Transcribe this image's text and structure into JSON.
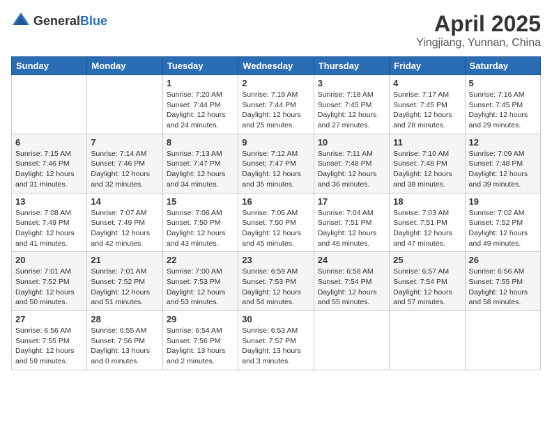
{
  "header": {
    "logo_general": "General",
    "logo_blue": "Blue",
    "month": "April 2025",
    "location": "Yingjiang, Yunnan, China"
  },
  "weekdays": [
    "Sunday",
    "Monday",
    "Tuesday",
    "Wednesday",
    "Thursday",
    "Friday",
    "Saturday"
  ],
  "weeks": [
    [
      {
        "day": "",
        "info": ""
      },
      {
        "day": "",
        "info": ""
      },
      {
        "day": "1",
        "info": "Sunrise: 7:20 AM\nSunset: 7:44 PM\nDaylight: 12 hours\nand 24 minutes."
      },
      {
        "day": "2",
        "info": "Sunrise: 7:19 AM\nSunset: 7:44 PM\nDaylight: 12 hours\nand 25 minutes."
      },
      {
        "day": "3",
        "info": "Sunrise: 7:18 AM\nSunset: 7:45 PM\nDaylight: 12 hours\nand 27 minutes."
      },
      {
        "day": "4",
        "info": "Sunrise: 7:17 AM\nSunset: 7:45 PM\nDaylight: 12 hours\nand 28 minutes."
      },
      {
        "day": "5",
        "info": "Sunrise: 7:16 AM\nSunset: 7:45 PM\nDaylight: 12 hours\nand 29 minutes."
      }
    ],
    [
      {
        "day": "6",
        "info": "Sunrise: 7:15 AM\nSunset: 7:46 PM\nDaylight: 12 hours\nand 31 minutes."
      },
      {
        "day": "7",
        "info": "Sunrise: 7:14 AM\nSunset: 7:46 PM\nDaylight: 12 hours\nand 32 minutes."
      },
      {
        "day": "8",
        "info": "Sunrise: 7:13 AM\nSunset: 7:47 PM\nDaylight: 12 hours\nand 34 minutes."
      },
      {
        "day": "9",
        "info": "Sunrise: 7:12 AM\nSunset: 7:47 PM\nDaylight: 12 hours\nand 35 minutes."
      },
      {
        "day": "10",
        "info": "Sunrise: 7:11 AM\nSunset: 7:48 PM\nDaylight: 12 hours\nand 36 minutes."
      },
      {
        "day": "11",
        "info": "Sunrise: 7:10 AM\nSunset: 7:48 PM\nDaylight: 12 hours\nand 38 minutes."
      },
      {
        "day": "12",
        "info": "Sunrise: 7:09 AM\nSunset: 7:48 PM\nDaylight: 12 hours\nand 39 minutes."
      }
    ],
    [
      {
        "day": "13",
        "info": "Sunrise: 7:08 AM\nSunset: 7:49 PM\nDaylight: 12 hours\nand 41 minutes."
      },
      {
        "day": "14",
        "info": "Sunrise: 7:07 AM\nSunset: 7:49 PM\nDaylight: 12 hours\nand 42 minutes."
      },
      {
        "day": "15",
        "info": "Sunrise: 7:06 AM\nSunset: 7:50 PM\nDaylight: 12 hours\nand 43 minutes."
      },
      {
        "day": "16",
        "info": "Sunrise: 7:05 AM\nSunset: 7:50 PM\nDaylight: 12 hours\nand 45 minutes."
      },
      {
        "day": "17",
        "info": "Sunrise: 7:04 AM\nSunset: 7:51 PM\nDaylight: 12 hours\nand 46 minutes."
      },
      {
        "day": "18",
        "info": "Sunrise: 7:03 AM\nSunset: 7:51 PM\nDaylight: 12 hours\nand 47 minutes."
      },
      {
        "day": "19",
        "info": "Sunrise: 7:02 AM\nSunset: 7:52 PM\nDaylight: 12 hours\nand 49 minutes."
      }
    ],
    [
      {
        "day": "20",
        "info": "Sunrise: 7:01 AM\nSunset: 7:52 PM\nDaylight: 12 hours\nand 50 minutes."
      },
      {
        "day": "21",
        "info": "Sunrise: 7:01 AM\nSunset: 7:52 PM\nDaylight: 12 hours\nand 51 minutes."
      },
      {
        "day": "22",
        "info": "Sunrise: 7:00 AM\nSunset: 7:53 PM\nDaylight: 12 hours\nand 53 minutes."
      },
      {
        "day": "23",
        "info": "Sunrise: 6:59 AM\nSunset: 7:53 PM\nDaylight: 12 hours\nand 54 minutes."
      },
      {
        "day": "24",
        "info": "Sunrise: 6:58 AM\nSunset: 7:54 PM\nDaylight: 12 hours\nand 55 minutes."
      },
      {
        "day": "25",
        "info": "Sunrise: 6:57 AM\nSunset: 7:54 PM\nDaylight: 12 hours\nand 57 minutes."
      },
      {
        "day": "26",
        "info": "Sunrise: 6:56 AM\nSunset: 7:55 PM\nDaylight: 12 hours\nand 58 minutes."
      }
    ],
    [
      {
        "day": "27",
        "info": "Sunrise: 6:56 AM\nSunset: 7:55 PM\nDaylight: 12 hours\nand 59 minutes."
      },
      {
        "day": "28",
        "info": "Sunrise: 6:55 AM\nSunset: 7:56 PM\nDaylight: 13 hours\nand 0 minutes."
      },
      {
        "day": "29",
        "info": "Sunrise: 6:54 AM\nSunset: 7:56 PM\nDaylight: 13 hours\nand 2 minutes."
      },
      {
        "day": "30",
        "info": "Sunrise: 6:53 AM\nSunset: 7:57 PM\nDaylight: 13 hours\nand 3 minutes."
      },
      {
        "day": "",
        "info": ""
      },
      {
        "day": "",
        "info": ""
      },
      {
        "day": "",
        "info": ""
      }
    ]
  ]
}
